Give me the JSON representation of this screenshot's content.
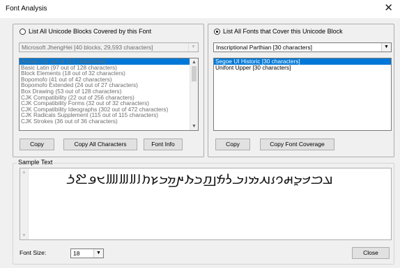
{
  "window": {
    "title": "Font Analysis",
    "close_glyph": "✕"
  },
  "left_panel": {
    "radio_label": "List All Unicode Blocks Covered by this Font",
    "radio_checked": false,
    "font_combo": "Microsoft JhengHei [40 blocks, 29,593 characters]",
    "blocks": [
      "Arrows (11 out of 112 characters)",
      "Basic Latin (97 out of 128 characters)",
      "Block Elements (18 out of 32 characters)",
      "Bopomofo (41 out of 42 characters)",
      "Bopomofo Extended (24 out of 27 characters)",
      "Box Drawing (53 out of 128 characters)",
      "CJK Compatibility (22 out of 256 characters)",
      "CJK Compatibility Forms (32 out of 32 characters)",
      "CJK Compatibility Ideographs (302 out of 472 characters)",
      "CJK Radicals Supplement (115 out of 115 characters)",
      "CJK Strokes (36 out of 36 characters)"
    ],
    "buttons": {
      "copy": "Copy",
      "copy_all": "Copy All Characters",
      "font_info": "Font Info"
    }
  },
  "right_panel": {
    "radio_label": "List All Fonts that Cover this Unicode Block",
    "radio_checked": true,
    "block_combo": "Inscriptional Parthian [30 characters]",
    "fonts": [
      "Segoe UI Historic [30 characters]",
      "Unifont Upper [30 characters]"
    ],
    "buttons": {
      "copy": "Copy",
      "copy_coverage": "Copy Font Coverage"
    }
  },
  "sample": {
    "legend": "Sample Text",
    "text": "𐭀𐭁𐭂𐭃𐭄𐭅𐭆𐭇𐭈𐭉𐭊𐭋𐭌𐭍𐭎𐭏𐭐𐭑𐭒𐭓𐭔𐭕𐭘𐭙𐭚𐭛𐭜𐭝𐭞𐭟"
  },
  "footer": {
    "font_size_label": "Font Size:",
    "font_size_value": "18",
    "close_label": "Close"
  }
}
